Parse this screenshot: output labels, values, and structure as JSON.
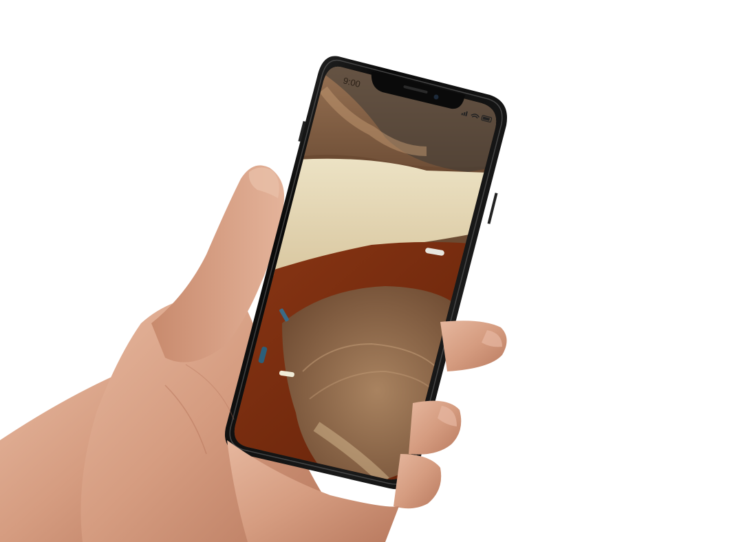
{
  "phone": {
    "status_bar": {
      "time": "9:00",
      "icons": [
        "signal-icon",
        "wifi-icon",
        "battery-icon"
      ]
    },
    "wallpaper": {
      "description_colors": [
        "#8a6444",
        "#e3d6b4",
        "#7a2e12",
        "#b58a5c",
        "#3a3a38"
      ]
    }
  },
  "colors": {
    "background": "#ffffff",
    "phone_frame": "#0d0d0d",
    "skin": "#d9a58a"
  }
}
